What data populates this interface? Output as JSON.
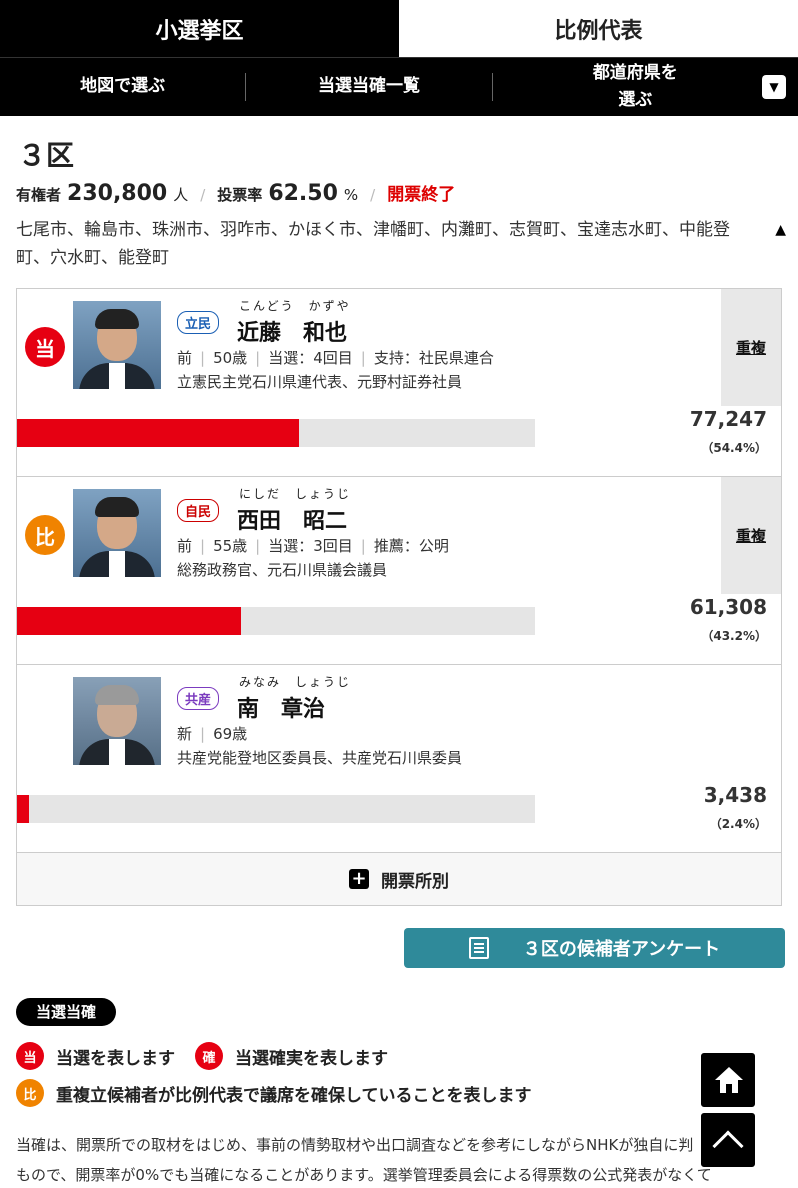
{
  "tabs": [
    {
      "label": "小選挙区",
      "active": true
    },
    {
      "label": "比例代表",
      "active": false
    }
  ],
  "subnav": {
    "map_label": "地図で選ぶ",
    "list_label": "当選当確一覧",
    "pref_label_line1": "都道府県を",
    "pref_label_line2": "選ぶ",
    "dropdown_icon": "▼"
  },
  "district": {
    "title": "３区",
    "electorate_label": "有権者",
    "electorate_value": "230,800",
    "electorate_unit": "人",
    "turnout_label": "投票率",
    "turnout_value": "62.50",
    "turnout_unit": "%",
    "status": "開票終了",
    "areas": "七尾市、輪島市、珠洲市、羽咋市、かほく市、津幡町、内灘町、志賀町、宝達志水町、中能登町、穴水町、能登町",
    "collapse_icon": "▲"
  },
  "candidates": [
    {
      "badge": "当",
      "party": "立民",
      "kana": "こんどう　かずや",
      "name": "近藤　和也",
      "status": "前",
      "age": "50歳",
      "wins": "当選：4回目",
      "support": "支持：社民県連合",
      "career": "立憲民主党石川県連代表、元野村証券社員",
      "dual": "重複",
      "votes": "77,247",
      "pct": "（54.4%）",
      "share": 0.544
    },
    {
      "badge": "比",
      "party": "自民",
      "kana": "にしだ　しょうじ",
      "name": "西田　昭二",
      "status": "前",
      "age": "55歳",
      "wins": "当選：3回目",
      "support": "推薦：公明",
      "career": "総務政務官、元石川県議会議員",
      "dual": "重複",
      "votes": "61,308",
      "pct": "（43.2%）",
      "share": 0.432
    },
    {
      "badge": "",
      "party": "共産",
      "kana": "みなみ　しょうじ",
      "name": "南　章治",
      "status": "新",
      "age": "69歳",
      "career": "共産党能登地区委員長、共産党石川県委員",
      "votes": "3,438",
      "pct": "（2.4%）",
      "share": 0.024
    }
  ],
  "by_place": {
    "icon": "+",
    "label": "開票所別"
  },
  "survey_button": "３区の候補者アンケート",
  "legend": {
    "pill": "当選当確",
    "win_mark": "当",
    "win_text": "当選を表します",
    "sure_mark": "確",
    "sure_text": "当選確実を表します",
    "hirei_mark": "比",
    "hirei_text": "重複立候補者が比例代表で議席を確保していることを表します"
  },
  "note_line1": "当確は、開票所での取材をはじめ、事前の情勢取材や出口調査などを参考にしながらNHKが独自に判",
  "note_line2": "もので、開票率が0%でも当確になることがあります。選挙管理委員会による得票数の公式発表がなくて",
  "colors": {
    "win": "#e60012",
    "hirei": "#f08300",
    "accent": "#2f8a9a"
  }
}
